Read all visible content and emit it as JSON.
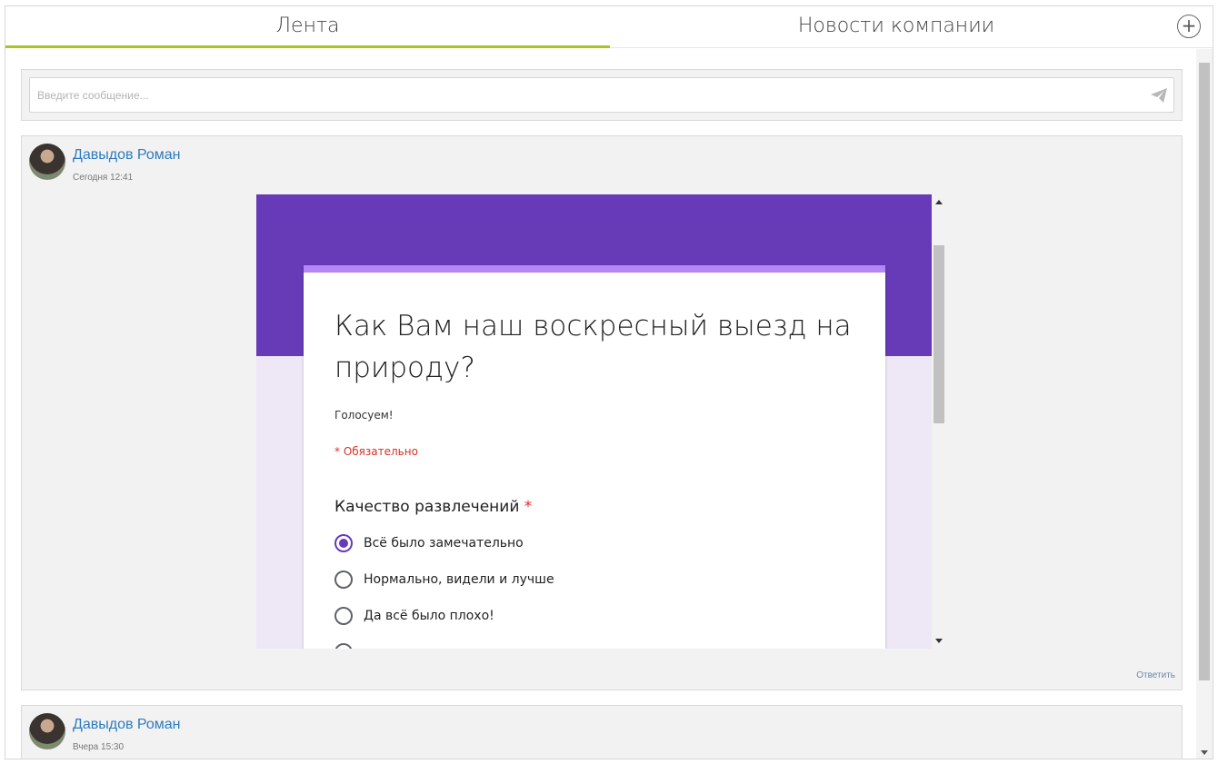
{
  "tabs": [
    {
      "label": "Лента",
      "active": true
    },
    {
      "label": "Новости компании",
      "active": false
    }
  ],
  "colors": {
    "accent": "#a8c520",
    "link": "#2e7bbf",
    "form_header": "#673ab7",
    "form_bg": "#ede7f6",
    "required": "#d93025"
  },
  "icons": {
    "add": "plus-circle-icon",
    "send": "paper-plane-icon"
  },
  "compose": {
    "placeholder": "Введите сообщение..."
  },
  "posts": [
    {
      "author": "Давыдов Роман",
      "time": "Сегодня 12:41",
      "reply_label": "Ответить",
      "form": {
        "title": "Как Вам наш воскресный выезд на природу?",
        "description": "Голосуем!",
        "required_note": "* Обязательно",
        "question": "Качество развлечений",
        "required_mark": "*",
        "options": [
          {
            "label": "Всё было замечательно",
            "selected": true
          },
          {
            "label": "Нормально, видели и лучше",
            "selected": false
          },
          {
            "label": "Да всё было плохо!",
            "selected": false
          }
        ]
      }
    },
    {
      "author": "Давыдов Роман",
      "time": "Вчера 15:30"
    }
  ]
}
